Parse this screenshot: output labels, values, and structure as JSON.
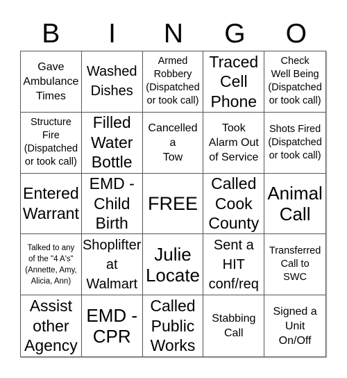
{
  "header": {
    "letters": [
      "B",
      "I",
      "N",
      "G",
      "O"
    ]
  },
  "board": {
    "cells": [
      {
        "text": "Gave\nAmbulance\nTimes",
        "size": "sz-m"
      },
      {
        "text": "Washed\nDishes",
        "size": "sz-l"
      },
      {
        "text": "Armed\nRobbery\n(Dispatched\nor took call)",
        "size": "sz-s"
      },
      {
        "text": "Traced\nCell\nPhone",
        "size": "sz-xl"
      },
      {
        "text": "Check\nWell Being\n(Dispatched\nor took call)",
        "size": "sz-s"
      },
      {
        "text": "Structure\nFire\n(Dispatched\nor took call)",
        "size": "sz-s"
      },
      {
        "text": "Filled\nWater\nBottle",
        "size": "sz-xl"
      },
      {
        "text": "Cancelled\na\nTow",
        "size": "sz-m"
      },
      {
        "text": "Took\nAlarm Out\nof Service",
        "size": "sz-m"
      },
      {
        "text": "Shots Fired\n(Dispatched\nor took call)",
        "size": "sz-s"
      },
      {
        "text": "Entered\nWarrant",
        "size": "sz-xl"
      },
      {
        "text": "EMD -\nChild\nBirth",
        "size": "sz-xl"
      },
      {
        "text": "FREE",
        "size": "sz-free"
      },
      {
        "text": "Called\nCook\nCounty",
        "size": "sz-xl"
      },
      {
        "text": "Animal\nCall",
        "size": "sz-xxl"
      },
      {
        "text": "Talked to any\nof the \"4 A's\"\n(Annette, Amy,\nAlicia, Ann)",
        "size": "sz-xs"
      },
      {
        "text": "Shoplifter\nat\nWalmart",
        "size": "sz-l"
      },
      {
        "text": "Julie\nLocate",
        "size": "sz-xxl"
      },
      {
        "text": "Sent a\nHIT\nconf/req",
        "size": "sz-l"
      },
      {
        "text": "Transferred\nCall to\nSWC",
        "size": "sz-s"
      },
      {
        "text": "Assist\nother\nAgency",
        "size": "sz-xl"
      },
      {
        "text": "EMD -\nCPR",
        "size": "sz-xxl"
      },
      {
        "text": "Called\nPublic\nWorks",
        "size": "sz-xl"
      },
      {
        "text": "Stabbing\nCall",
        "size": "sz-m"
      },
      {
        "text": "Signed a\nUnit\nOn/Off",
        "size": "sz-m"
      }
    ]
  }
}
